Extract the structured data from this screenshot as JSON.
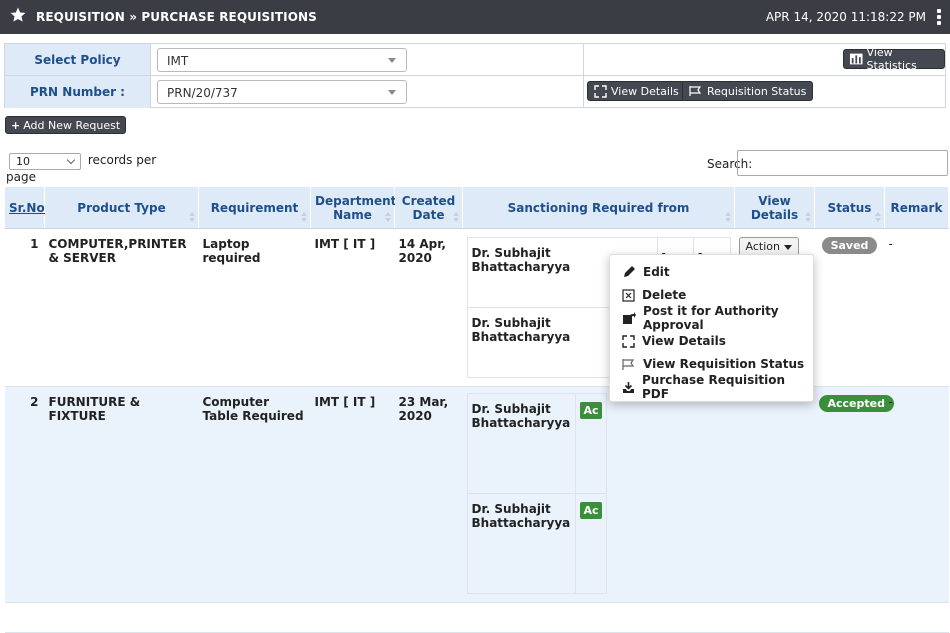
{
  "header": {
    "title": "REQUISITION » PURCHASE REQUISITIONS",
    "datetime": "APR 14, 2020  11:18:22 PM"
  },
  "filters": {
    "policy_label": "Select Policy",
    "policy_value": "IMT",
    "prn_label": "PRN Number :",
    "prn_value": "PRN/20/737",
    "view_statistics": "View Statistics",
    "view_details": "View Details",
    "requisition_status": "Requisition Status"
  },
  "toolbar": {
    "add_new_request": "Add New Request"
  },
  "length": {
    "value": "10",
    "after": "records per",
    "page_word": "page"
  },
  "search": {
    "label": "Search:"
  },
  "table": {
    "columns": [
      "Sr.No.",
      "Product Type",
      "Requirement",
      "Department Name",
      "Created Date",
      "Sanctioning Required from",
      "View Details",
      "Status",
      "Remark"
    ],
    "rows": [
      {
        "srno": "1",
        "product_type": "COMPUTER,PRINTER & SERVER",
        "requirement": "Laptop required",
        "department": "IMT [ IT ]",
        "created": "14 Apr, 2020",
        "sanction": [
          {
            "name": "Dr. Subhajit Bhattacharyya",
            "c2": "-",
            "c3": "-"
          },
          {
            "name": "Dr. Subhajit Bhattacharyya",
            "c2": "",
            "c3": ""
          }
        ],
        "action": "Action",
        "status": "Saved",
        "remark": "-"
      },
      {
        "srno": "2",
        "product_type": "FURNITURE & FIXTURE",
        "requirement": "Computer Table Required",
        "department": "IMT [ IT ]",
        "created": "23 Mar, 2020",
        "sanction": [
          {
            "name": "Dr. Subhajit Bhattacharyya",
            "tag": "Ac"
          },
          {
            "name": "Dr. Subhajit Bhattacharyya",
            "tag": "Ac"
          }
        ],
        "status": "Accepted",
        "remark": "-"
      }
    ]
  },
  "menu": {
    "items": [
      "Edit",
      "Delete",
      "Post it for Authority Approval",
      "View Details",
      "View Requisition Status",
      "Purchase Requisition PDF"
    ]
  },
  "colors": {
    "topbar": "#3a3d44",
    "header_bg": "#dfeaf8",
    "header_text": "#1d4f8c",
    "accepted": "#3a8f3a",
    "saved": "#8a8a8a"
  }
}
